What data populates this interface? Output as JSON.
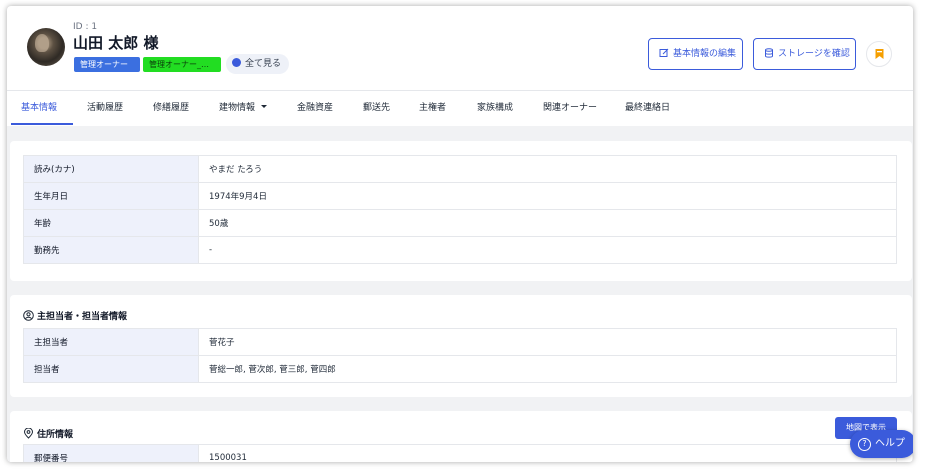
{
  "header": {
    "id_label": "ID : 1",
    "name": "山田 太郎 様",
    "tags": [
      "管理オーナー",
      "管理オーナー_…"
    ],
    "see_all": "全て見る",
    "edit_button": "基本情報の編集",
    "storage_button": "ストレージを確認"
  },
  "tabs": [
    {
      "label": "基本情報",
      "active": true
    },
    {
      "label": "活動履歴"
    },
    {
      "label": "修繕履歴"
    },
    {
      "label": "建物情報"
    },
    {
      "label": "金融資産"
    },
    {
      "label": "郵送先"
    },
    {
      "label": "主権者"
    },
    {
      "label": "家族構成"
    },
    {
      "label": "関連オーナー"
    },
    {
      "label": "最終連絡日"
    }
  ],
  "basic": {
    "rows": [
      {
        "label": "読み(カナ)",
        "value": "やまだ たろう"
      },
      {
        "label": "生年月日",
        "value": "1974年9月4日"
      },
      {
        "label": "年齢",
        "value": "50歳"
      },
      {
        "label": "勤務先",
        "value": "-"
      }
    ]
  },
  "staff": {
    "title": "主担当者・担当者情報",
    "rows": [
      {
        "label": "主担当者",
        "value": "菅花子"
      },
      {
        "label": "担当者",
        "value": "菅総一郎, 菅次郎, 菅三郎, 菅四郎"
      }
    ]
  },
  "address": {
    "title": "住所情報",
    "map_button": "地図で表示",
    "rows": [
      {
        "label": "郵便番号",
        "value": "1500031"
      }
    ]
  },
  "help_button": "ヘルプ",
  "colors": {
    "accent": "#3b5bdb",
    "tag_blue": "#3b6fe0",
    "tag_green": "#22dd22",
    "bookmark": "#f59f00"
  }
}
